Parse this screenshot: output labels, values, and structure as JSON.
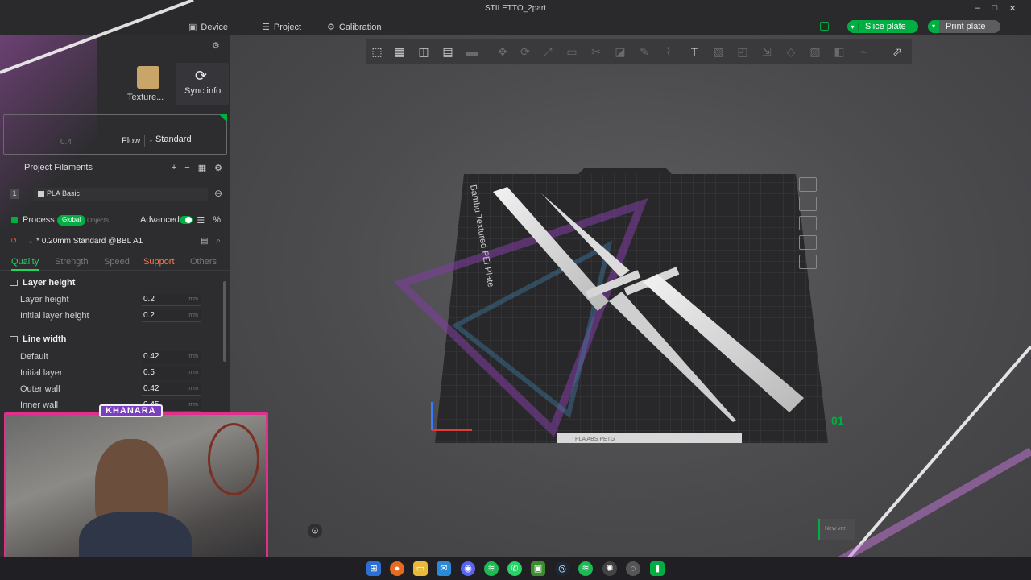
{
  "window": {
    "title": "STILETTO_2part"
  },
  "menubar": {
    "device": "Device",
    "project": "Project",
    "calibration": "Calibration",
    "slice_plate": "Slice plate",
    "print_plate": "Print plate"
  },
  "left": {
    "texture_label": "Texture...",
    "sync_label": "Sync info",
    "nozzle_value": "0.4",
    "flow_label": "Flow",
    "flow_value": "Standard",
    "project_filaments": "Project Filaments",
    "filament": {
      "index": "1",
      "name": "PLA Basic"
    },
    "process": {
      "label": "Process",
      "global": "Global",
      "objects": "Objects",
      "advanced": "Advanced",
      "preset": "* 0.20mm Standard @BBL A1"
    },
    "tabs": [
      {
        "label": "Quality"
      },
      {
        "label": "Strength"
      },
      {
        "label": "Speed"
      },
      {
        "label": "Support"
      },
      {
        "label": "Others"
      }
    ],
    "groups": {
      "layer_height": "Layer height",
      "line_width": "Line width"
    },
    "params": [
      {
        "label": "Layer height",
        "value": "0.2",
        "unit": "mm"
      },
      {
        "label": "Initial layer height",
        "value": "0.2",
        "unit": "mm"
      },
      {
        "label": "Default",
        "value": "0.42",
        "unit": "mm"
      },
      {
        "label": "Initial layer",
        "value": "0.5",
        "unit": "mm"
      },
      {
        "label": "Outer wall",
        "value": "0.42",
        "unit": "mm"
      },
      {
        "label": "Inner wall",
        "value": "0.45",
        "unit": "mm"
      }
    ]
  },
  "view": {
    "plate_label": "Bambu Textured PEI Plate",
    "plate_number": "01",
    "plate_bar": "PLA ABS PETG",
    "new_version": "New ver"
  },
  "overlay": {
    "streamer_tag": "KHANARA"
  },
  "colors": {
    "accent": "#00ae42",
    "cam_border": "#e0308c"
  }
}
